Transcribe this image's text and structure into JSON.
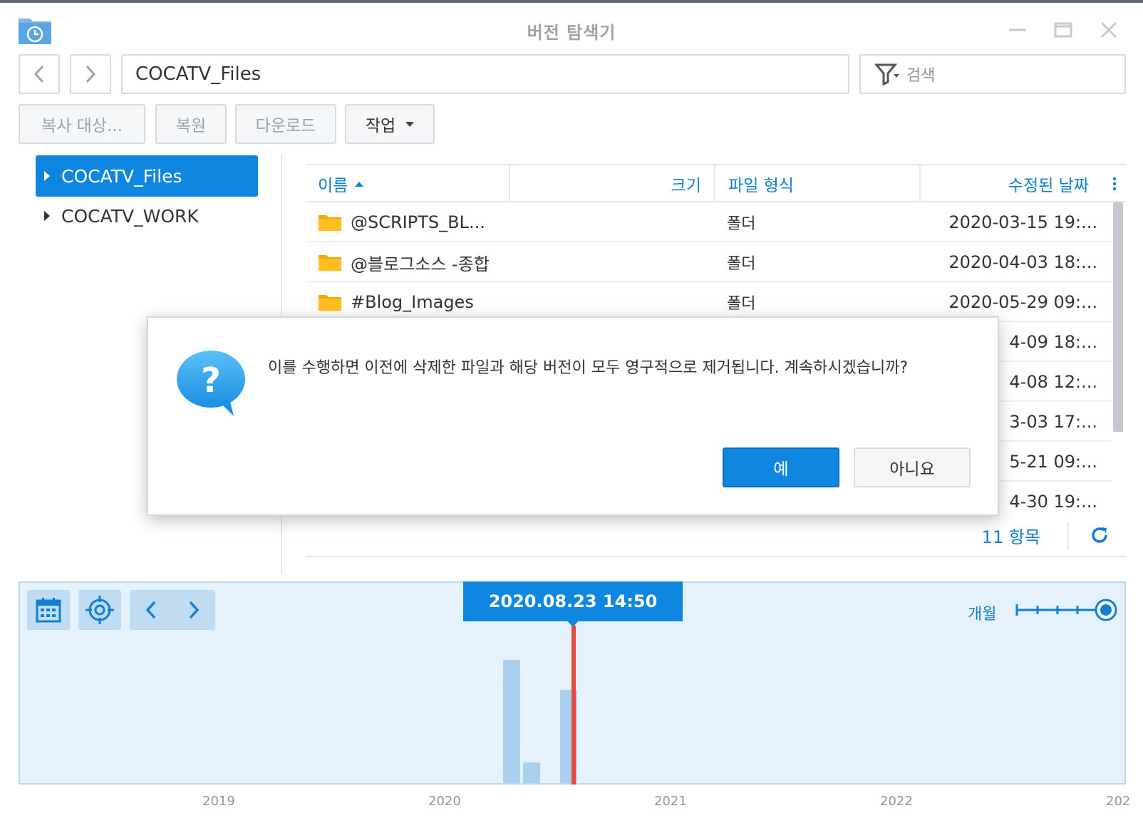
{
  "window": {
    "title": "버전 탐색기"
  },
  "navigation": {
    "path": "COCATV_Files",
    "search_placeholder": "검색"
  },
  "toolbar": {
    "copy_label": "복사 대상...",
    "restore_label": "복원",
    "download_label": "다운로드",
    "action_label": "작업"
  },
  "tree": {
    "items": [
      {
        "label": "COCATV_Files",
        "selected": true
      },
      {
        "label": "COCATV_WORK",
        "selected": false
      }
    ]
  },
  "table": {
    "headers": {
      "name": "이름",
      "size": "크기",
      "type": "파일 형식",
      "date": "수정된 날짜"
    },
    "rows": [
      {
        "name": "@SCRIPTS_BL...",
        "size": "",
        "type": "폴더",
        "date": "2020-03-15 19:..."
      },
      {
        "name": "@블로그소스 -종합",
        "size": "",
        "type": "폴더",
        "date": "2020-04-03 18:..."
      },
      {
        "name": "#Blog_Images",
        "size": "",
        "type": "폴더",
        "date": "2020-05-29 09:..."
      },
      {
        "name": "",
        "size": "",
        "type": "",
        "date": "4-09 18:..."
      },
      {
        "name": "",
        "size": "",
        "type": "",
        "date": "4-08 12:..."
      },
      {
        "name": "",
        "size": "",
        "type": "",
        "date": "3-03 17:..."
      },
      {
        "name": "",
        "size": "",
        "type": "",
        "date": "5-21 09:..."
      },
      {
        "name": "",
        "size": "",
        "type": "",
        "date": "4-30 19:..."
      }
    ],
    "item_count": "11 항목"
  },
  "timeline": {
    "selected_date": "2020.08.23 14:50",
    "zoom_label": "개월",
    "years": [
      "2019",
      "2020",
      "2021",
      "2022",
      "202"
    ]
  },
  "dialog": {
    "message": "이를 수행하면 이전에 삭제한 파일과 해당 버전이 모두 영구적으로 제거됩니다. 계속하시겠습니까?",
    "yes_label": "예",
    "no_label": "아니요"
  },
  "colors": {
    "accent": "#0f86e0",
    "timeline_bg": "#e6f2fb",
    "marker": "#e8483f",
    "folder": "#f5a800"
  }
}
